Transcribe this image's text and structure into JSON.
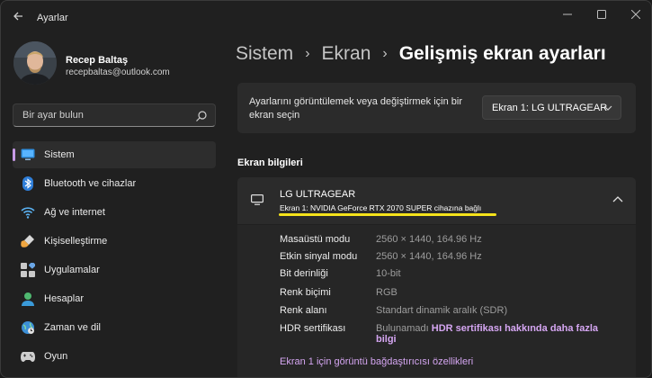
{
  "app": {
    "title": "Ayarlar"
  },
  "user": {
    "name": "Recep Baltaş",
    "email": "recepbaltas@outlook.com"
  },
  "search": {
    "placeholder": "Bir ayar bulun"
  },
  "sidebar": {
    "items": [
      {
        "label": "Sistem",
        "icon": "system-icon",
        "active": true
      },
      {
        "label": "Bluetooth ve cihazlar",
        "icon": "bluetooth-icon"
      },
      {
        "label": "Ağ ve internet",
        "icon": "wifi-icon"
      },
      {
        "label": "Kişiselleştirme",
        "icon": "brush-icon"
      },
      {
        "label": "Uygulamalar",
        "icon": "apps-icon"
      },
      {
        "label": "Hesaplar",
        "icon": "account-icon"
      },
      {
        "label": "Zaman ve dil",
        "icon": "globe-clock-icon"
      },
      {
        "label": "Oyun",
        "icon": "gamepad-icon"
      }
    ]
  },
  "breadcrumb": {
    "level1": "Sistem",
    "level2": "Ekran",
    "current": "Gelişmiş ekran ayarları"
  },
  "display_select": {
    "prompt": "Ayarlarını görüntülemek veya değiştirmek için bir ekran seçin",
    "selected": "Ekran 1: LG ULTRAGEAR"
  },
  "display_info": {
    "section_title": "Ekran bilgileri",
    "monitor_name": "LG ULTRAGEAR",
    "monitor_sub": "Ekran 1: NVIDIA GeForce RTX 2070 SUPER cihazına bağlı",
    "rows": [
      {
        "key": "Masaüstü modu",
        "value": "2560 × 1440, 164.96 Hz"
      },
      {
        "key": "Etkin sinyal modu",
        "value": "2560 × 1440, 164.96 Hz"
      },
      {
        "key": "Bit derinliği",
        "value": "10-bit"
      },
      {
        "key": "Renk biçimi",
        "value": "RGB"
      },
      {
        "key": "Renk alanı",
        "value": "Standart dinamik aralık (SDR)"
      }
    ],
    "hdr_key": "HDR sertifikası",
    "hdr_value": "Bulunamadı",
    "hdr_link_line1": "HDR sertifikası hakkında daha fazla",
    "hdr_link_line2": "bilgi",
    "adapter_link": "Ekran 1 için görüntü bağdaştırıcısı özellikleri"
  },
  "colors": {
    "accent": "#d5a6f2",
    "highlight": "#f5e21b",
    "background": "#202020",
    "card": "#2b2b2b"
  }
}
